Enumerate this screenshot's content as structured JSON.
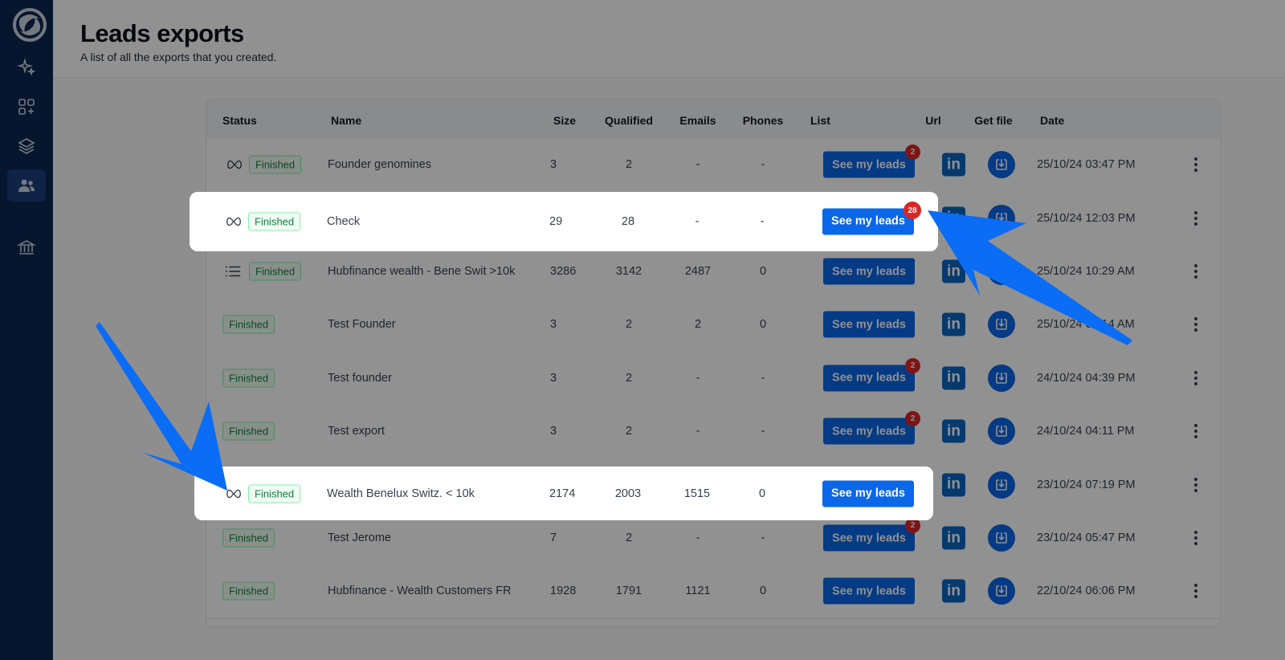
{
  "header": {
    "title": "Leads exports",
    "subtitle": "A list of all the exports that you created."
  },
  "sidebar": {
    "items": [
      {
        "icon": "sparkles-icon"
      },
      {
        "icon": "grid-plus-icon"
      },
      {
        "icon": "layers-icon"
      },
      {
        "icon": "users-icon",
        "active": true
      },
      {
        "icon": "bank-icon"
      }
    ]
  },
  "table": {
    "columns": [
      "Status",
      "Name",
      "Size",
      "Qualified",
      "Emails",
      "Phones",
      "List",
      "Url",
      "Get file",
      "Date"
    ],
    "button_label": "See my leads",
    "linkedin_label": "in",
    "rows": [
      {
        "icon": "infinity",
        "status": "Finished",
        "name": "Founder genomines",
        "size": "3",
        "qualified": "2",
        "emails": "-",
        "phones": "-",
        "badge": "2",
        "date": "25/10/24 03:47 PM"
      },
      {
        "icon": "infinity",
        "status": "Finished",
        "name": "Check",
        "size": "29",
        "qualified": "28",
        "emails": "-",
        "phones": "-",
        "badge": "28",
        "date": "25/10/24 12:03 PM"
      },
      {
        "icon": "list",
        "status": "Finished",
        "name": "Hubfinance wealth - Bene Swit >10k",
        "size": "3286",
        "qualified": "3142",
        "emails": "2487",
        "phones": "0",
        "badge": "",
        "date": "25/10/24 10:29 AM"
      },
      {
        "icon": "",
        "status": "Finished",
        "name": "Test Founder",
        "size": "3",
        "qualified": "2",
        "emails": "2",
        "phones": "0",
        "badge": "",
        "date": "25/10/24 09:14 AM"
      },
      {
        "icon": "",
        "status": "Finished",
        "name": "Test founder",
        "size": "3",
        "qualified": "2",
        "emails": "-",
        "phones": "-",
        "badge": "2",
        "date": "24/10/24 04:39 PM"
      },
      {
        "icon": "",
        "status": "Finished",
        "name": "Test export",
        "size": "3",
        "qualified": "2",
        "emails": "-",
        "phones": "-",
        "badge": "2",
        "date": "24/10/24 04:11 PM"
      },
      {
        "icon": "infinity",
        "status": "Finished",
        "name": "Wealth Benelux Switz. < 10k",
        "size": "2174",
        "qualified": "2003",
        "emails": "1515",
        "phones": "0",
        "badge": "",
        "date": "23/10/24 07:19 PM"
      },
      {
        "icon": "",
        "status": "Finished",
        "name": "Test Jerome",
        "size": "7",
        "qualified": "2",
        "emails": "-",
        "phones": "-",
        "badge": "2",
        "date": "23/10/24 05:47 PM"
      },
      {
        "icon": "",
        "status": "Finished",
        "name": "Hubfinance - Wealth Customers FR",
        "size": "1928",
        "qualified": "1791",
        "emails": "1121",
        "phones": "0",
        "badge": "",
        "date": "22/10/24 06:06 PM"
      }
    ]
  },
  "colors": {
    "sidebar": "#0d2854",
    "accent": "#0a67e8",
    "annotation_arrow": "#0b6cf5",
    "badge_red": "#dc2626"
  }
}
